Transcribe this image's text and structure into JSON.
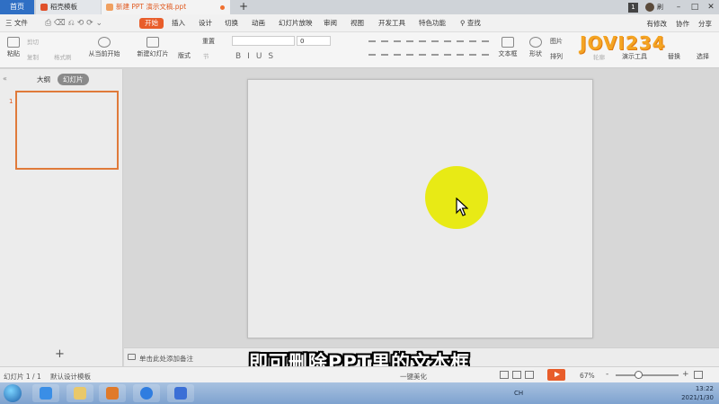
{
  "tabbar": {
    "home_label": "首页",
    "tabs": [
      {
        "label": "稻壳模板"
      },
      {
        "label": "新建 PPT 演示文稿.ppt"
      }
    ],
    "new_tab": "+",
    "badge": "1",
    "user": "刷"
  },
  "menubar": {
    "file": "三 文件",
    "items": [
      "开始",
      "插入",
      "设计",
      "切换",
      "动画",
      "幻灯片放映",
      "审阅",
      "视图",
      "开发工具",
      "特色功能",
      "查找"
    ],
    "right": {
      "unsaved": "有修改",
      "collab": "协作",
      "share": "分享"
    }
  },
  "ribbon": {
    "paste": "粘贴",
    "cut": "剪切",
    "copy": "复制",
    "format_painter": "格式刷",
    "from_current": "从当前开始",
    "new_slide": "新建幻灯片",
    "layout": "版式",
    "section": "节",
    "reset": "重置",
    "font_size": "0",
    "text_box": "文本框",
    "shape": "形状",
    "arrange": "排列",
    "picture": "图片",
    "outline": "轮廓",
    "present_tools": "演示工具",
    "replace": "替换",
    "select": "选择"
  },
  "logo": "JOVI234",
  "left_panel": {
    "collapse": "«",
    "tab_outline": "大纲",
    "tab_slides": "幻灯片",
    "slide_number": "1",
    "add": "+"
  },
  "notes": {
    "placeholder": "单击此处添加备注"
  },
  "subtitle": "即可删除PPT里的文本框",
  "statusbar": {
    "slide_info": "幻灯片 1 / 1",
    "theme": "默认设计模板",
    "beautify": "一键美化",
    "zoom": "67%",
    "minus": "-",
    "plus": "+"
  },
  "taskbar": {
    "tray": "CH",
    "time": "13:22",
    "date": "2021/1/30"
  },
  "colors": {
    "accent": "#e85d2a",
    "highlight": "#e8ea15",
    "home_tab": "#2f6fc4"
  }
}
